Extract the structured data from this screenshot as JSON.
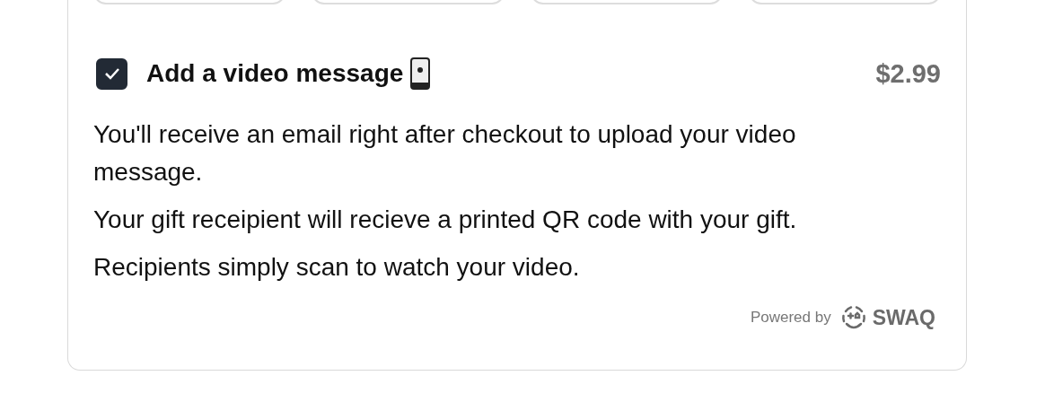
{
  "option_buttons": [
    {
      "kind": "pill"
    },
    {
      "kind": "pill"
    },
    {
      "kind": "pill"
    },
    {
      "kind": "pill"
    }
  ],
  "addon": {
    "checked": true,
    "title": "Add a video message",
    "price": "$2.99"
  },
  "description": [
    "You'll receive an email right after checkout to upload your video message.",
    "Your gift receipient will recieve a printed QR code with your gift.",
    "Recipients simply scan to watch your video."
  ],
  "footer": {
    "powered_by": "Powered by",
    "brand": "SWAQ"
  }
}
